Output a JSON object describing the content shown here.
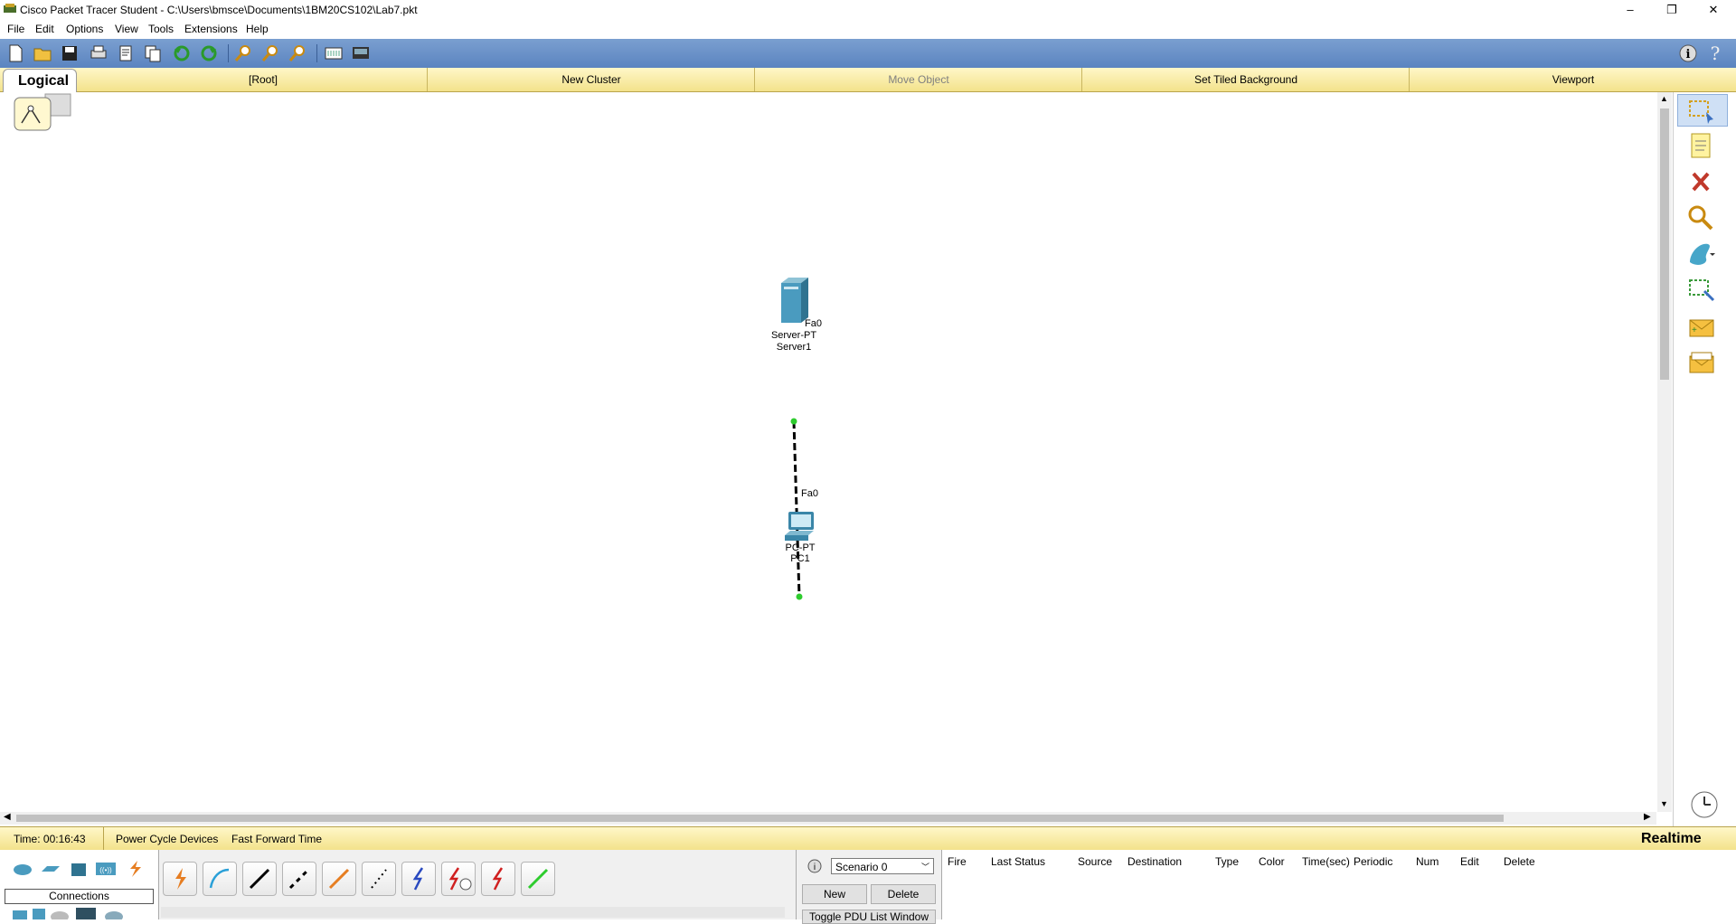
{
  "window": {
    "title": "Cisco Packet Tracer Student - C:\\Users\\bmsce\\Documents\\1BM20CS102\\Lab7.pkt",
    "minimize": "–",
    "restore": "❐",
    "close": "✕"
  },
  "menu": [
    "File",
    "Edit",
    "Options",
    "View",
    "Tools",
    "Extensions",
    "Help"
  ],
  "workspace_bar": {
    "logical_tab": "Logical",
    "root": "[Root]",
    "new_cluster": "New Cluster",
    "move_object": "Move Object",
    "set_tiled_background": "Set Tiled Background",
    "viewport": "Viewport"
  },
  "devices": {
    "server": {
      "model": "Server-PT",
      "name": "Server1",
      "port": "Fa0"
    },
    "pc": {
      "model": "PC-PT",
      "name": "PC1",
      "port": "Fa0"
    }
  },
  "status": {
    "time": "Time: 00:16:43",
    "power_cycle": "Power Cycle Devices",
    "fast_forward": "Fast Forward Time",
    "mode": "Realtime"
  },
  "device_panel": {
    "category_label": "Connections"
  },
  "scenario": {
    "selected": "Scenario 0",
    "new_label": "New",
    "delete_label": "Delete",
    "toggle_label": "Toggle PDU List Window"
  },
  "pdu_columns": [
    "Fire",
    "Last Status",
    "Source",
    "Destination",
    "Type",
    "Color",
    "Time(sec)",
    "Periodic",
    "Num",
    "Edit",
    "Delete"
  ],
  "colors": {
    "toolbar": "#5b84c0",
    "workspace_bar": "#f3e28b",
    "link_light": "#2ecc2e"
  }
}
